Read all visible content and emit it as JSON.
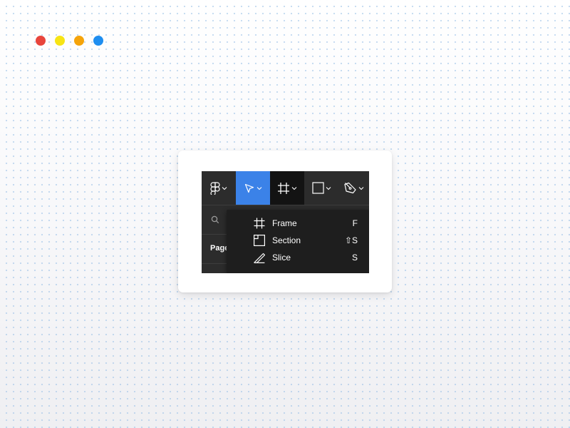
{
  "colors": {
    "dot_red": "#e8453c",
    "dot_yellow": "#f7e414",
    "dot_orange": "#f5a40a",
    "dot_blue": "#1e8ef0",
    "accent": "#3b82e8",
    "toolbar_bg": "#2c2c2c",
    "menu_bg": "#1e1e1e"
  },
  "toolbar": {
    "tools": [
      {
        "name": "main-menu",
        "icon": "figma-logo-icon"
      },
      {
        "name": "move",
        "icon": "cursor-arrow-icon",
        "active": true
      },
      {
        "name": "frame",
        "icon": "frame-hash-icon",
        "selected": true
      },
      {
        "name": "shape",
        "icon": "rectangle-icon"
      },
      {
        "name": "pen",
        "icon": "pen-nib-icon"
      }
    ]
  },
  "sidebar": {
    "pages_label": "Page"
  },
  "dropdown": {
    "items": [
      {
        "label": "Frame",
        "shortcut": "F",
        "icon": "frame-hash-icon"
      },
      {
        "label": "Section",
        "shortcut": "⇧S",
        "icon": "section-icon"
      },
      {
        "label": "Slice",
        "shortcut": "S",
        "icon": "slice-knife-icon"
      }
    ]
  }
}
